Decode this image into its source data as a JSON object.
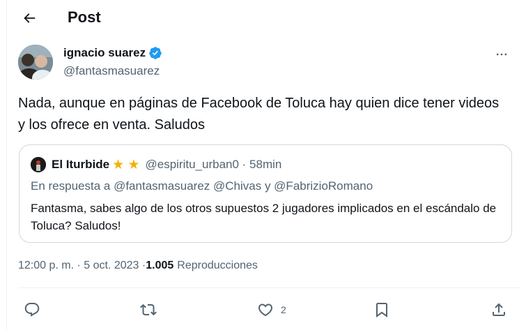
{
  "header": {
    "title": "Post"
  },
  "post": {
    "author_name": "ignacio suarez",
    "author_handle": "@fantasmasuarez",
    "verified": true,
    "text": "Nada, aunque en páginas de Facebook de Toluca hay quien dice tener videos y los ofrece en venta. Saludos",
    "time": "12:00 p. m. · 5 oct. 2023 · ",
    "views_count": "1.005",
    "views_label": "Reproducciones"
  },
  "quote": {
    "author_name": "El Iturbide",
    "stars": "★ ★",
    "handle_time": "@espiritu_urban0 · 58min",
    "reply_to": "En respuesta a @fantasmasuarez @Chivas y @FabrizioRomano",
    "text": "Fantasma, sabes algo de los otros supuestos 2 jugadores implicados en el escándalo de Toluca? Saludos!"
  },
  "actions": {
    "reply_icon": "reply-icon",
    "repost_icon": "repost-icon",
    "like_icon": "heart-icon",
    "like_count": "2",
    "bookmark_icon": "bookmark-icon",
    "share_icon": "share-icon"
  },
  "colors": {
    "text_primary": "#0f1419",
    "text_secondary": "#536471",
    "verified_blue": "#1d9bf0",
    "star": "#f4b000",
    "border": "#cfd9de"
  }
}
